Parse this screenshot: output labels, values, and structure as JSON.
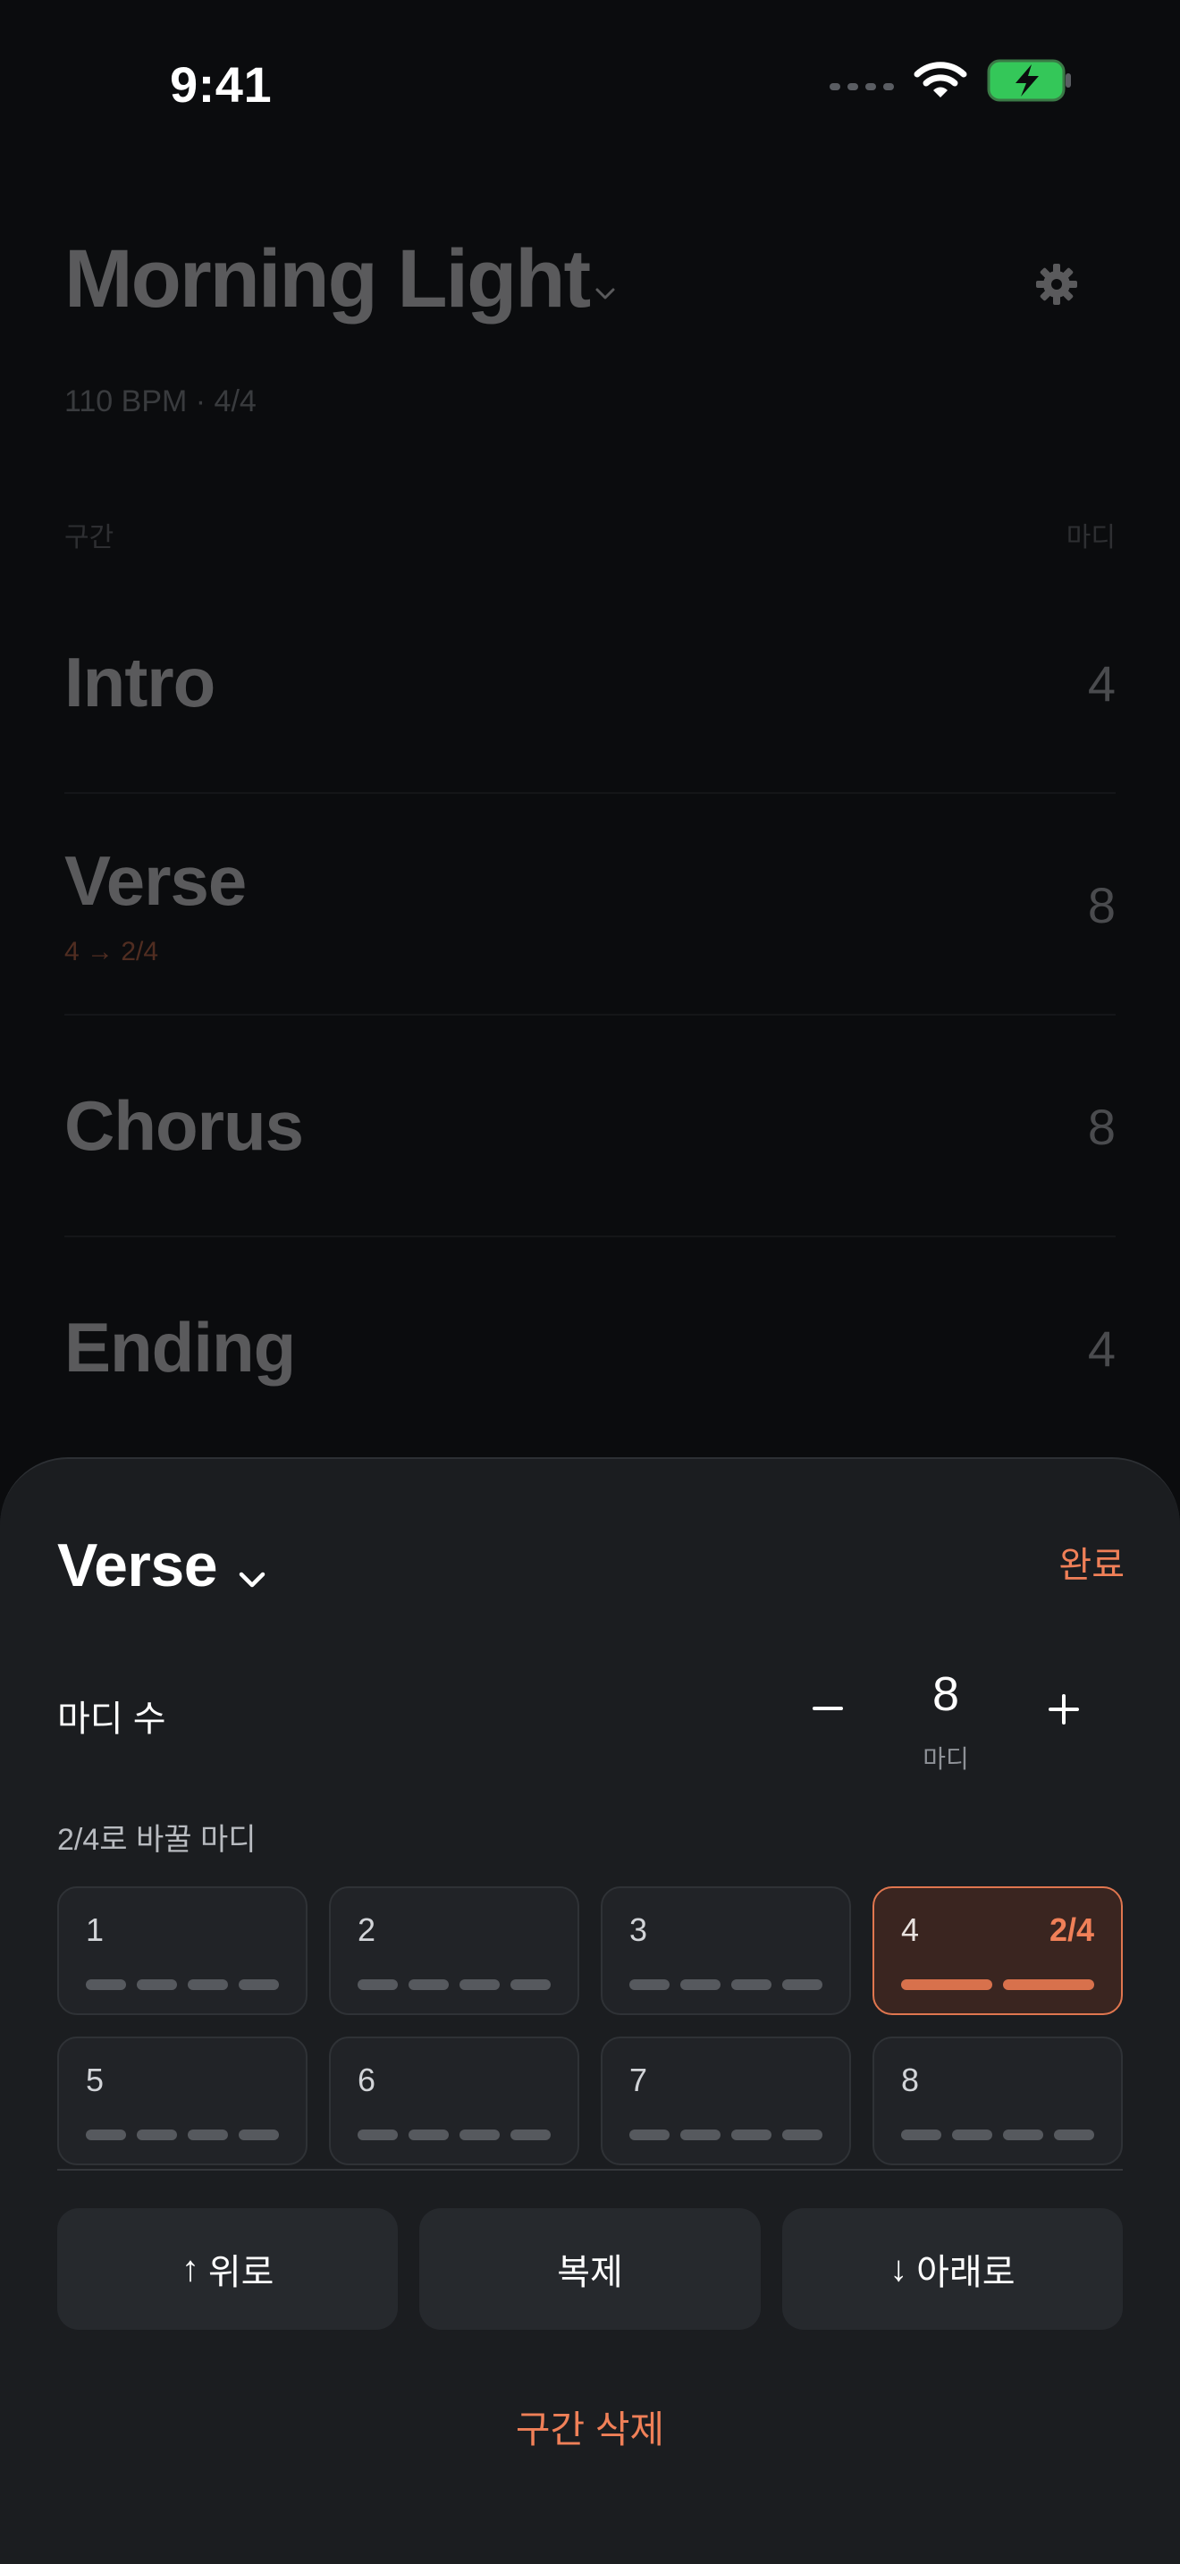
{
  "status_bar": {
    "time": "9:41"
  },
  "song": {
    "title": "Morning Light",
    "meta": "110 BPM · 4/4",
    "column_left": "구간",
    "column_right": "마디",
    "sections": [
      {
        "name": "Intro",
        "bars": "4",
        "sub": ""
      },
      {
        "name": "Verse",
        "bars": "8",
        "sub": "4 → 2/4"
      },
      {
        "name": "Chorus",
        "bars": "8",
        "sub": ""
      },
      {
        "name": "Ending",
        "bars": "4",
        "sub": ""
      }
    ]
  },
  "sheet": {
    "title": "Verse",
    "done_label": "완료",
    "bars_label": "마디 수",
    "bars_value": "8",
    "bars_unit": "마디",
    "minus_label": "–",
    "plus_label": "+",
    "switch_label": "2/4로 바꿀 마디",
    "measures": [
      {
        "number": "1",
        "badge": "",
        "beats": 4,
        "selected": false
      },
      {
        "number": "2",
        "badge": "",
        "beats": 4,
        "selected": false
      },
      {
        "number": "3",
        "badge": "",
        "beats": 4,
        "selected": false
      },
      {
        "number": "4",
        "badge": "2/4",
        "beats": 2,
        "selected": true
      },
      {
        "number": "5",
        "badge": "",
        "beats": 4,
        "selected": false
      },
      {
        "number": "6",
        "badge": "",
        "beats": 4,
        "selected": false
      },
      {
        "number": "7",
        "badge": "",
        "beats": 4,
        "selected": false
      },
      {
        "number": "8",
        "badge": "",
        "beats": 4,
        "selected": false
      }
    ],
    "actions": {
      "up_arrow": "↑",
      "up_label": "위로",
      "duplicate_label": "복제",
      "down_arrow": "↓",
      "down_label": "아래로"
    },
    "delete_label": "구간 삭제"
  },
  "colors": {
    "accent": "#f08058",
    "background": "#0b0c0e",
    "sheet": "#1b1d20",
    "battery": "#34c759"
  },
  "icons": {
    "signal": "cellular-signal-icon",
    "wifi": "wifi-icon",
    "battery": "battery-charging-icon",
    "settings": "gear-icon",
    "title_dropdown": "chevron-down-icon"
  }
}
